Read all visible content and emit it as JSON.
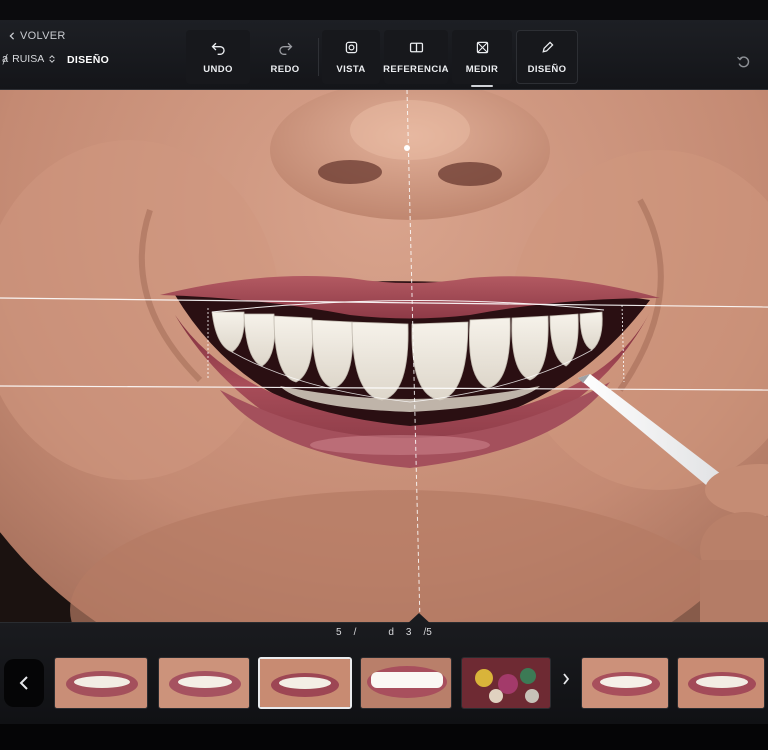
{
  "toolbar": {
    "back_label": "VOLVER",
    "project_label": "RUISA",
    "mode_label": "DISEÑO",
    "buttons": [
      {
        "icon": "undo-icon",
        "label": "UNDO"
      },
      {
        "icon": "redo-icon",
        "label": "REDO"
      },
      {
        "icon": "view-icon",
        "label": "VISTA"
      },
      {
        "icon": "reference-icon",
        "label": "REFERENCIA"
      },
      {
        "icon": "measure-icon",
        "label": "MEDIR",
        "active": true
      },
      {
        "icon": "pencil-icon",
        "label": "DISEÑO"
      }
    ]
  },
  "bottom": {
    "mini_tools": [
      "5",
      "/",
      "d",
      "3",
      "/5"
    ],
    "thumbnails": [
      {
        "kind": "smile",
        "selected": false
      },
      {
        "kind": "smile",
        "selected": false
      },
      {
        "kind": "smile",
        "selected": true
      },
      {
        "kind": "smile-white",
        "selected": false
      },
      {
        "kind": "smile-colorful",
        "selected": false
      },
      {
        "kind": "smile",
        "selected": false
      },
      {
        "kind": "smile",
        "selected": false
      }
    ]
  },
  "colors": {
    "toolbar_bg": "#1a1c20",
    "skin": "#c8907a",
    "lips": "#9c4350",
    "guides": "#ffffff"
  }
}
